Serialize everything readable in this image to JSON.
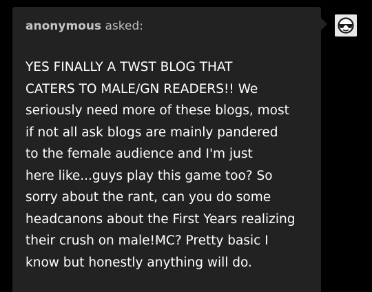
{
  "ask": {
    "asker": "anonymous",
    "asked_label": "asked:",
    "lines": [
      "YES FINALLY A TWST BLOG THAT",
      "CATERS TO MALE/GN READERS!! We",
      "seriously need more of these blogs, most",
      "if not all ask blogs are mainly pandered",
      "to the female audience and I'm just",
      "here like...guys play this game too? So",
      "sorry about the rant, can you do some",
      "headcanons about the First Years realizing",
      "their crush on male!MC? Pretty basic I",
      "know but honestly anything will do."
    ]
  },
  "avatar": {
    "icon": "anonymous-avatar-sunglasses-icon"
  },
  "colors": {
    "page_background": "#000000",
    "card_background": "#222222",
    "header_text": "#bdbdbd",
    "body_text": "#ffffff"
  }
}
